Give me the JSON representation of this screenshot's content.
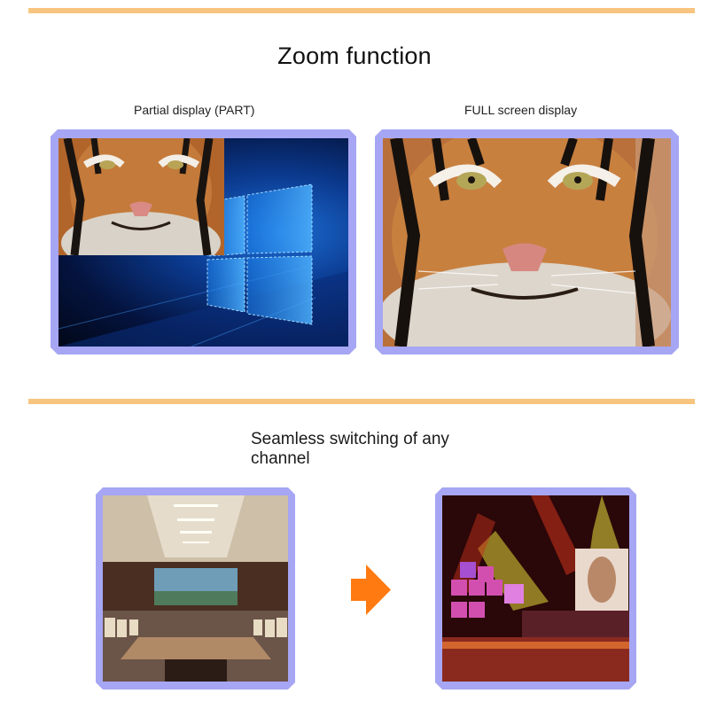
{
  "section1": {
    "title": "Zoom function",
    "left_caption": "Partial display (PART)",
    "right_caption": "FULL screen display",
    "left_image": "tiger-face-over-windows-desktop",
    "right_image": "tiger-face-fullscreen"
  },
  "section2": {
    "subtitle": "Seamless switching of any channel",
    "left_image": "conference-room-with-display-wall",
    "right_image": "concert-stage-with-led-screen",
    "arrow_icon": "arrow-right-icon"
  },
  "colors": {
    "divider": "#f7c57f",
    "frame": "#a6a6f4",
    "arrow": "#ff7a10"
  }
}
